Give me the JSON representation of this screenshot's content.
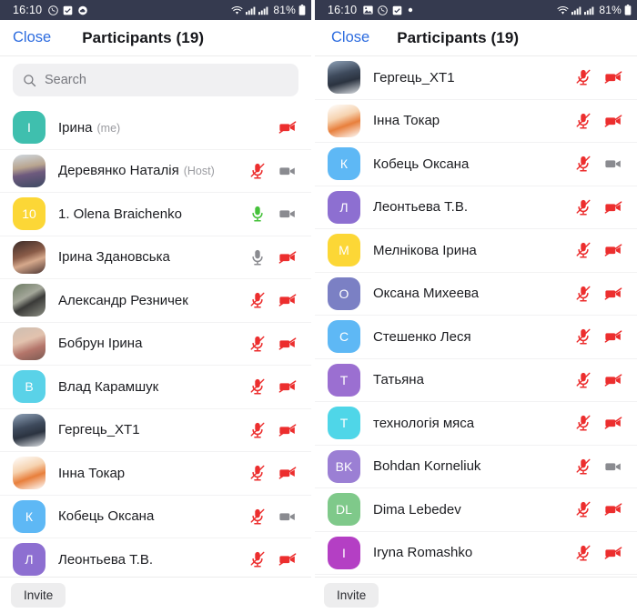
{
  "status_bar": {
    "time": "16:10",
    "battery": "81%",
    "left_icons_left_panel": [
      "viber-icon",
      "checkbox-icon",
      "cloud-icon"
    ],
    "left_icons_right_panel": [
      "image-icon",
      "viber-icon",
      "checkbox-icon",
      "dot-icon"
    ],
    "right_icons": [
      "wifi-icon",
      "signal-icon",
      "signal-icon",
      "battery-icon"
    ],
    "background": "#353a4f"
  },
  "nav": {
    "close_label": "Close",
    "title": "Participants (19)",
    "close_color": "#2d6cdf"
  },
  "search": {
    "placeholder": "Search",
    "icon": "search-icon"
  },
  "bottom": {
    "invite_label": "Invite"
  },
  "left_panel": {
    "participants": [
      {
        "name": "Ірина",
        "tag": "(me)",
        "avatar_type": "initial",
        "initial": "I",
        "color": "#3fbfae",
        "mic": "none",
        "cam": "off"
      },
      {
        "name": "Деревянко Наталія",
        "tag": "(Host)",
        "avatar_type": "photo",
        "photo": "photo-shelf",
        "mic": "muted",
        "cam": "on"
      },
      {
        "name": "1. Olena Braichenko",
        "tag": "",
        "avatar_type": "initial",
        "initial": "10",
        "color": "#fcd736",
        "mic": "unmuted",
        "cam": "on"
      },
      {
        "name": "Ірина Здановська",
        "tag": "",
        "avatar_type": "photo",
        "photo": "photo-woman-dark",
        "mic": "gray",
        "cam": "off"
      },
      {
        "name": "Александр Резничек",
        "tag": "",
        "avatar_type": "photo",
        "photo": "photo-street",
        "mic": "muted",
        "cam": "off"
      },
      {
        "name": "Бобрун Ірина",
        "tag": "",
        "avatar_type": "photo",
        "photo": "photo-girl",
        "mic": "muted",
        "cam": "off"
      },
      {
        "name": "Влад Карамшук",
        "tag": "",
        "avatar_type": "initial",
        "initial": "В",
        "color": "#5ad2e8",
        "mic": "muted",
        "cam": "off"
      },
      {
        "name": "Гергець_ХТ1",
        "tag": "",
        "avatar_type": "photo",
        "photo": "photo-hat",
        "mic": "muted",
        "cam": "off"
      },
      {
        "name": "Інна Токар",
        "tag": "",
        "avatar_type": "photo",
        "photo": "photo-fox",
        "mic": "muted",
        "cam": "off"
      },
      {
        "name": "Кобець Оксана",
        "tag": "",
        "avatar_type": "initial",
        "initial": "К",
        "color": "#5eb8f5",
        "mic": "muted",
        "cam": "on"
      },
      {
        "name": "Леонтьева Т.В.",
        "tag": "",
        "avatar_type": "initial",
        "initial": "Л",
        "color": "#8d6fd1",
        "mic": "muted",
        "cam": "off"
      }
    ]
  },
  "right_panel": {
    "participants": [
      {
        "name": "Гергець_ХТ1",
        "tag": "",
        "avatar_type": "photo",
        "photo": "photo-hat",
        "mic": "muted",
        "cam": "off"
      },
      {
        "name": "Інна Токар",
        "tag": "",
        "avatar_type": "photo",
        "photo": "photo-fox",
        "mic": "muted",
        "cam": "off"
      },
      {
        "name": "Кобець Оксана",
        "tag": "",
        "avatar_type": "initial",
        "initial": "К",
        "color": "#5eb8f5",
        "mic": "muted",
        "cam": "on"
      },
      {
        "name": "Леонтьева Т.В.",
        "tag": "",
        "avatar_type": "initial",
        "initial": "Л",
        "color": "#8d6fd1",
        "mic": "muted",
        "cam": "off"
      },
      {
        "name": "Мелнікова Ірина",
        "tag": "",
        "avatar_type": "initial",
        "initial": "М",
        "color": "#fcd736",
        "mic": "muted",
        "cam": "off"
      },
      {
        "name": "Оксана Михеева",
        "tag": "",
        "avatar_type": "initial",
        "initial": "О",
        "color": "#7b80c4",
        "mic": "muted",
        "cam": "off"
      },
      {
        "name": "Стешенко Леся",
        "tag": "",
        "avatar_type": "initial",
        "initial": "С",
        "color": "#5eb8f5",
        "mic": "muted",
        "cam": "off"
      },
      {
        "name": "Татьяна",
        "tag": "",
        "avatar_type": "initial",
        "initial": "Т",
        "color": "#9b6fd1",
        "mic": "muted",
        "cam": "off"
      },
      {
        "name": "технологія мяса",
        "tag": "",
        "avatar_type": "initial",
        "initial": "Т",
        "color": "#4fd6e8",
        "mic": "muted",
        "cam": "off"
      },
      {
        "name": "Bohdan Korneliuk",
        "tag": "",
        "avatar_type": "initial",
        "initial": "BK",
        "color": "#9b7fd4",
        "mic": "muted",
        "cam": "on"
      },
      {
        "name": "Dima Lebedev",
        "tag": "",
        "avatar_type": "initial",
        "initial": "DL",
        "color": "#7fc98a",
        "mic": "muted",
        "cam": "off"
      },
      {
        "name": "Iryna Romashko",
        "tag": "",
        "avatar_type": "initial",
        "initial": "I",
        "color": "#b43fc4",
        "mic": "muted",
        "cam": "off"
      }
    ]
  },
  "colors": {
    "mic_muted": "#ec2e2e",
    "mic_unmuted": "#45c13a",
    "mic_gray": "#8a8b90",
    "cam_on": "#8a8b90",
    "cam_off": "#ec2e2e"
  }
}
